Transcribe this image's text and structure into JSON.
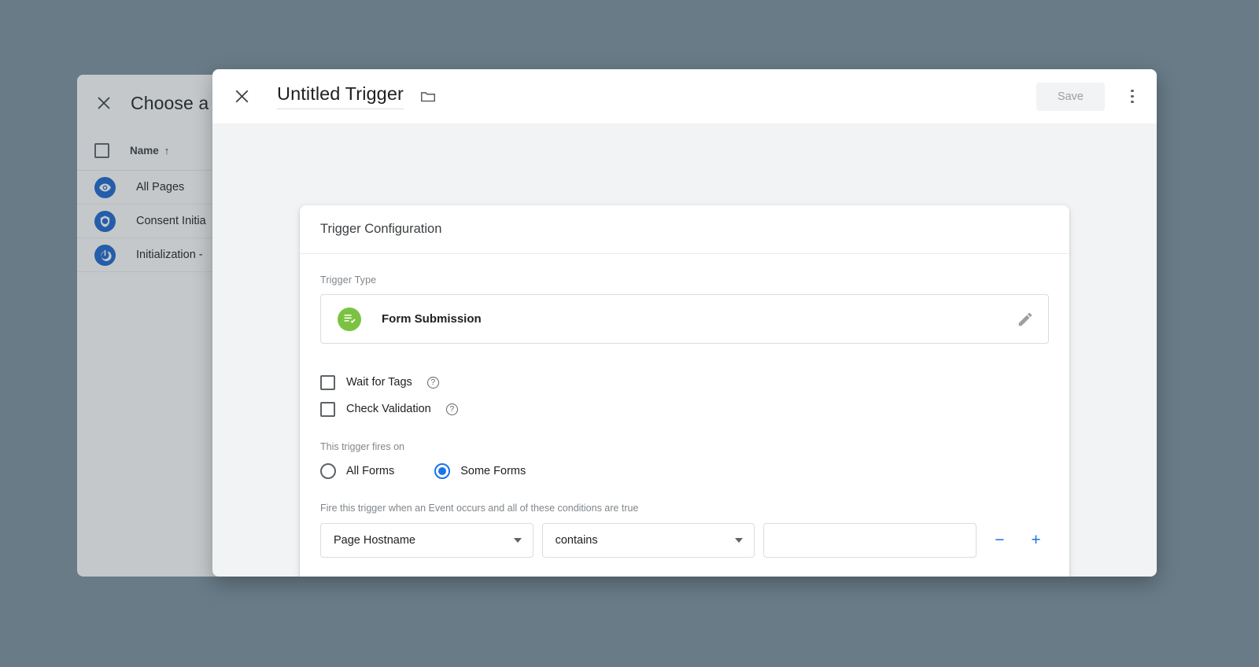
{
  "background_panel": {
    "close_icon": "close-icon",
    "title": "Choose a",
    "column_header": "Name",
    "sort_arrow": "↑",
    "rows": [
      {
        "icon": "eye-icon",
        "label": "All Pages"
      },
      {
        "icon": "shield-icon",
        "label": "Consent Initia"
      },
      {
        "icon": "power-icon",
        "label": "Initialization -"
      }
    ]
  },
  "modal": {
    "close_icon": "close-icon",
    "title": "Untitled Trigger",
    "folder_icon": "folder-icon",
    "save_label": "Save",
    "menu_icon": "more-vertical-icon",
    "card": {
      "heading": "Trigger Configuration",
      "trigger_type_label": "Trigger Type",
      "trigger_type": {
        "icon": "form-submission-icon",
        "icon_color": "#7cc242",
        "name": "Form Submission",
        "edit_icon": "pencil-icon"
      },
      "checkboxes": [
        {
          "label": "Wait for Tags",
          "checked": false,
          "help": "?"
        },
        {
          "label": "Check Validation",
          "checked": false,
          "help": "?"
        }
      ],
      "fires_on_label": "This trigger fires on",
      "radios": [
        {
          "label": "All Forms",
          "selected": false
        },
        {
          "label": "Some Forms",
          "selected": true
        }
      ],
      "conditions_label": "Fire this trigger when an Event occurs and all of these conditions are true",
      "condition": {
        "variable": "Page Hostname",
        "operator": "contains",
        "value": "",
        "value_placeholder": "",
        "remove_label": "−",
        "add_label": "+"
      }
    }
  },
  "colors": {
    "page_background": "#687b87",
    "modal_background": "#f1f3f4",
    "accent_blue": "#1a73e8",
    "trigger_green": "#7cc242",
    "list_icon_blue": "#1a66d0"
  }
}
